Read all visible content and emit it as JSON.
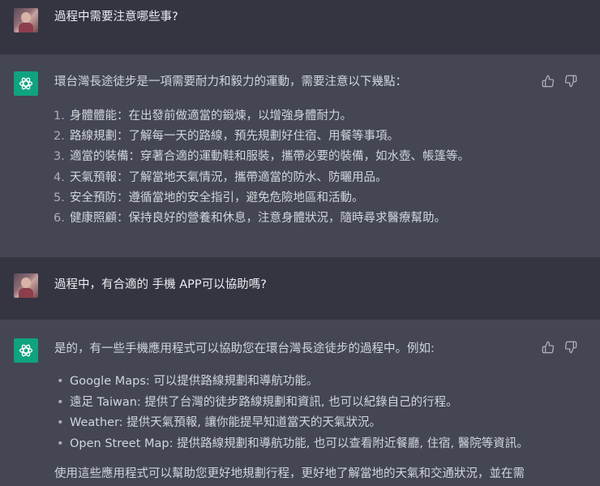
{
  "conversation": {
    "msg1": {
      "text": "過程中需要注意哪些事?"
    },
    "reply1": {
      "intro": "環台灣長途徒步是一項需要耐力和毅力的運動，需要注意以下幾點：",
      "items": [
        {
          "num": "1.",
          "text": "身體體能：在出發前做適當的鍛煉，以增強身體耐力。"
        },
        {
          "num": "2.",
          "text": "路線規劃：了解每一天的路線，預先規劃好住宿、用餐等事項。"
        },
        {
          "num": "3.",
          "text": "適當的裝備：穿著合適的運動鞋和服裝，攜帶必要的裝備，如水壺、帳篷等。"
        },
        {
          "num": "4.",
          "text": "天氣預報：了解當地天氣情況，攜帶適當的防水、防曬用品。"
        },
        {
          "num": "5.",
          "text": "安全預防：遵循當地的安全指引，避免危險地區和活動。"
        },
        {
          "num": "6.",
          "text": "健康照顧：保持良好的營養和休息，注意身體狀況，隨時尋求醫療幫助。"
        }
      ]
    },
    "msg2": {
      "text": "過程中，有合適的 手機 APP可以協助嗎?"
    },
    "reply2": {
      "intro": "是的，有一些手機應用程式可以協助您在環台灣長途徒步的過程中。例如:",
      "bullets": [
        "Google Maps: 可以提供路線規劃和導航功能。",
        "遠足 Taiwan: 提供了台灣的徒步路線規劃和資訊, 也可以紀錄自己的行程。",
        "Weather: 提供天氣預報, 讓你能提早知道當天的天氣狀況。",
        "Open Street Map: 提供路線規劃和導航功能, 也可以查看附近餐廳, 住宿, 醫院等資訊。"
      ],
      "outro": "使用這些應用程式可以幫助您更好地規劃行程，更好地了解當地的天氣和交通狀況，並在需"
    }
  },
  "icons": {
    "user_avatar": "user-avatar",
    "bot_avatar": "openai-logo-icon",
    "like": "thumbs-up-icon",
    "dislike": "thumbs-down-icon"
  },
  "colors": {
    "user_bg": "#343541",
    "assistant_bg": "#444654",
    "brand_green": "#10a37f",
    "text": "#d1d5db"
  }
}
